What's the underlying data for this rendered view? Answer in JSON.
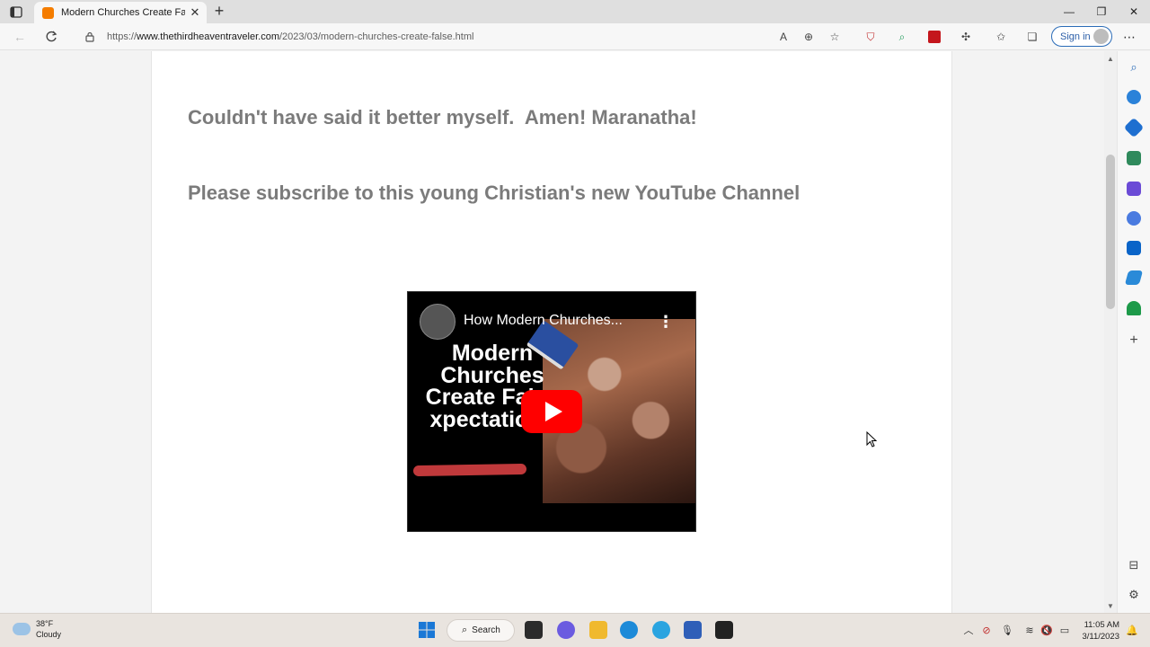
{
  "browser": {
    "tab_title": "Modern Churches Create False E",
    "url_prefix": "https://",
    "url_host": "www.thethirdheaventraveler.com",
    "url_path": "/2023/03/modern-churches-create-false.html",
    "sign_in_label": "Sign in",
    "new_tab_symbol": "+",
    "close_symbol": "✕"
  },
  "page": {
    "heading_1": "Couldn't have said it better myself.  Amen! Maranatha!",
    "heading_2": "Please subscribe to this young Christian's new YouTube Channel",
    "video": {
      "title": "How Modern Churches...",
      "thumbnail_text": "Modern Churches Create False xpectations",
      "menu_symbol": "⋮"
    }
  },
  "taskbar": {
    "weather_temp": "38°F",
    "weather_condition": "Cloudy",
    "search_label": "Search",
    "time": "11:05 AM",
    "date": "3/11/2023"
  },
  "colors": {
    "heading": "#7b7b7b",
    "play_button": "#ff0000",
    "accent": "#2b6cb8"
  }
}
